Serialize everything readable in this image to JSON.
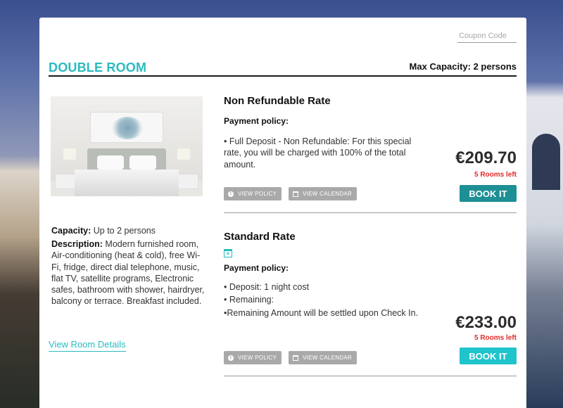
{
  "colors": {
    "accent": "#2bbbc0",
    "book_dark": "#1e8f94",
    "book_light": "#20c4cc",
    "rooms_left": "#e02a2a",
    "pill_gray": "#a9a9a9"
  },
  "coupon": {
    "placeholder": "Coupon Code",
    "value": ""
  },
  "room": {
    "title": "DOUBLE ROOM",
    "max_capacity": "Max Capacity: 2 persons",
    "capacity_label": "Capacity:",
    "capacity_value": " Up to 2 persons",
    "description_label": "Description:",
    "description_value": " Modern furnished room, Air-conditioning (heat & cold), free Wi-Fi, fridge, direct dial telephone, music, flat TV, satellite programs, Electronic safes, bathroom with shower, hairdryer, balcony or terrace. Breakfast included.",
    "view_details": "View Room Details",
    "photo_icon": "bedroom-photo"
  },
  "rates": [
    {
      "name": "Non Refundable Rate",
      "policy_label": "Payment policy:",
      "policy_lines": [
        "• Full Deposit - Non Refundable: For this special rate, you will be charged with 100% of the total amount."
      ],
      "price": "€209.70",
      "rooms_left": "5 Rooms left",
      "book_label": "BOOK IT",
      "view_policy": "VIEW POLICY",
      "view_calendar": "VIEW CALENDAR"
    },
    {
      "name": "Standard Rate",
      "icon": "calendar-x-icon",
      "policy_label": "Payment policy:",
      "policy_lines": [
        "• Deposit: 1 night cost",
        "• Remaining:",
        "•Remaining Amount will be settled upon Check In."
      ],
      "price": "€233.00",
      "rooms_left": "5 Rooms left",
      "book_label": "BOOK IT",
      "view_policy": "VIEW POLICY",
      "view_calendar": "VIEW CALENDAR"
    }
  ]
}
